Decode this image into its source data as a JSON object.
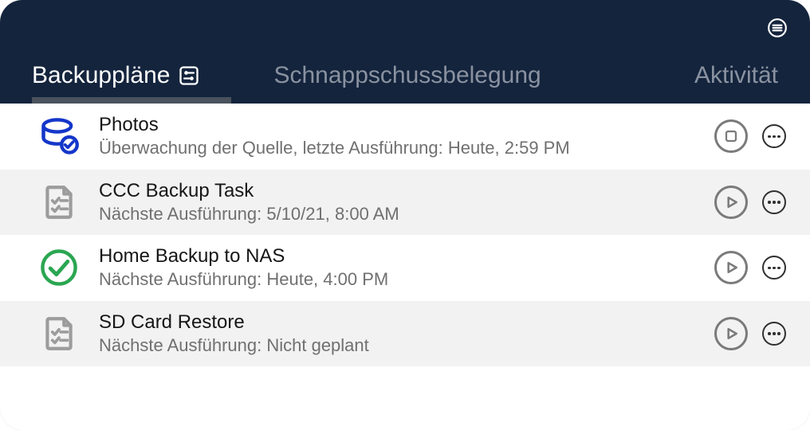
{
  "header": {
    "tabs": {
      "plans": "Backuppläne",
      "snapshots": "Schnappschussbelegung",
      "activity": "Aktivität"
    }
  },
  "rows": [
    {
      "title": "Photos",
      "subtitle": "Überwachung der Quelle, letzte Ausführung: Heute, 2:59 PM",
      "icon": "disk-monitoring",
      "action": "stop"
    },
    {
      "title": "CCC Backup Task",
      "subtitle": "Nächste Ausführung: 5/10/21, 8:00 AM",
      "icon": "task-file",
      "action": "play"
    },
    {
      "title": "Home Backup to NAS",
      "subtitle": "Nächste Ausführung: Heute, 4:00 PM",
      "icon": "success-check",
      "action": "play"
    },
    {
      "title": "SD Card Restore",
      "subtitle": "Nächste Ausführung: Nicht geplant",
      "icon": "task-file",
      "action": "play"
    }
  ]
}
